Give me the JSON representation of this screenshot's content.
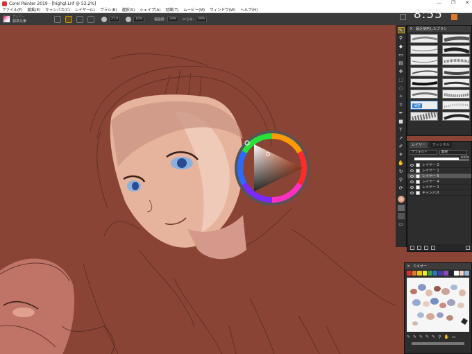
{
  "window": {
    "title": "Corel Painter 2019 - [highgl.Lrif @ 53.2%]",
    "controls": [
      "—",
      "❐",
      "✕"
    ]
  },
  "menu": [
    "ファイル(F)",
    "編集(E)",
    "キャンバス(C)",
    "レイヤー(L)",
    "ブラシ(B)",
    "選択(S)",
    "シェイプ(A)",
    "効果(T)",
    "ムービー(M)",
    "ウィンドウ(W)",
    "ヘルプ(H)"
  ],
  "toolbar": {
    "brush_category": "ディアー",
    "brush_variant": "標準丸筆",
    "size_value": "27.0",
    "opacity_value": "10%",
    "grain_label": "描画度:",
    "grain_value": "29%",
    "resat_label": "にじみ:",
    "resat_value": "40%"
  },
  "clock": "8:55",
  "tools": [
    "brush",
    "dropper",
    "paint-bucket",
    "eraser",
    "gradient",
    "transform",
    "select",
    "lasso",
    "magic-wand",
    "crop",
    "pen",
    "rectangle",
    "text",
    "shape-select",
    "pipette",
    "mirror",
    "pan",
    "rotate",
    "zoom",
    "color"
  ],
  "brush_library": {
    "title": "最近使用したブラシ",
    "selected_label": "薄塗",
    "cells": 16
  },
  "layers": {
    "tabs": [
      "レイヤー",
      "チャンネル"
    ],
    "composite": "デフォルト",
    "method": "無視",
    "opacity": "100%",
    "items": [
      {
        "name": "レイヤー 2",
        "selected": false
      },
      {
        "name": "レイヤー 1",
        "selected": false
      },
      {
        "name": "レイヤー 5",
        "selected": true
      },
      {
        "name": "レイヤー 4",
        "selected": false
      },
      {
        "name": "レイヤー 1",
        "selected": false
      },
      {
        "name": "キャンバス",
        "selected": false
      }
    ]
  },
  "mixer": {
    "title": "ミキサー",
    "swatches": [
      "#d63232",
      "#e07a2a",
      "#e6c419",
      "#f2ea28",
      "#3aa03a",
      "#1f7ac9",
      "#4b3ba8",
      "#8a4ab8",
      "#222222",
      "#ffffff",
      "#f1d2c3",
      "#9ab6d8"
    ]
  },
  "colors": {
    "canvas": "#8a4435",
    "accent": "#d3a020"
  }
}
